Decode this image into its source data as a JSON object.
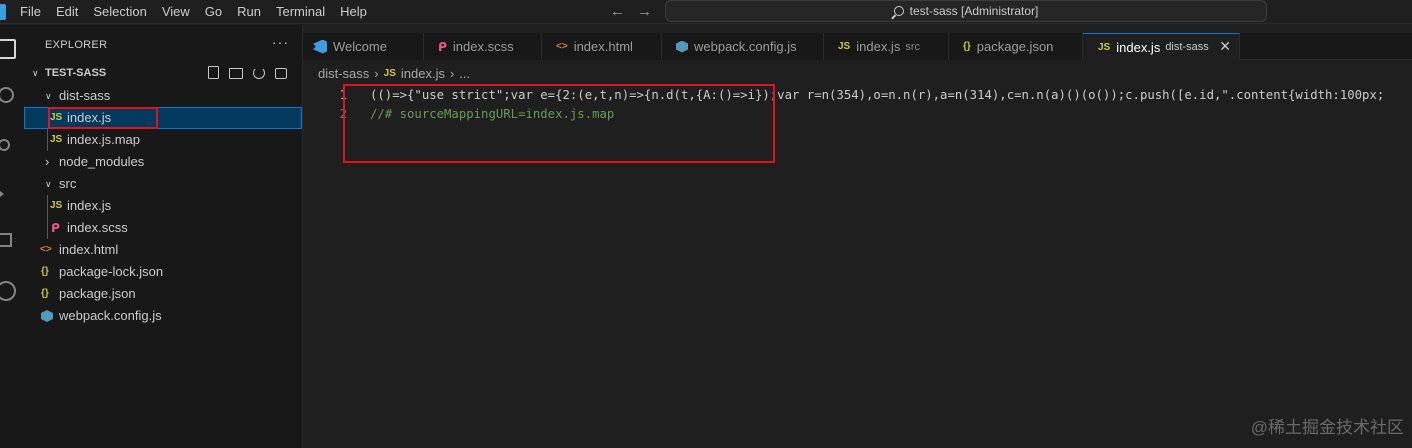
{
  "menu": [
    "File",
    "Edit",
    "Selection",
    "View",
    "Go",
    "Run",
    "Terminal",
    "Help"
  ],
  "nav": {
    "back": "←",
    "forward": "→"
  },
  "search": {
    "text": "test-sass [Administrator]"
  },
  "explorer": {
    "header": "EXPLORER",
    "more": "···",
    "section_title": "TEST-SASS",
    "tree": [
      {
        "label": "dist-sass",
        "type": "folder"
      },
      {
        "label": "index.js",
        "type": "js",
        "selected": true
      },
      {
        "label": "index.js.map",
        "type": "js"
      },
      {
        "label": "node_modules",
        "type": "folder-collapsed"
      },
      {
        "label": "src",
        "type": "folder"
      },
      {
        "label": "index.js",
        "type": "js"
      },
      {
        "label": "index.scss",
        "type": "scss"
      },
      {
        "label": "index.html",
        "type": "html"
      },
      {
        "label": "package-lock.json",
        "type": "json"
      },
      {
        "label": "package.json",
        "type": "json"
      },
      {
        "label": "webpack.config.js",
        "type": "webpack"
      }
    ],
    "icon_labels": {
      "js": "JS",
      "json": "{}",
      "html": "<>",
      "scss": "ᑭ",
      "folder_open": "∨",
      "folder_closed": "›"
    }
  },
  "tabs": [
    {
      "label": "Welcome",
      "icon": "vscode-icon"
    },
    {
      "label": "index.scss",
      "icon": "sass-icon",
      "icon_text": "ᑭ"
    },
    {
      "label": "index.html",
      "icon": "html-icon",
      "icon_text": "<>"
    },
    {
      "label": "webpack.config.js",
      "icon": "webpack-icon"
    },
    {
      "label": "index.js",
      "icon": "js-icon",
      "icon_text": "JS",
      "desc": "src"
    },
    {
      "label": "package.json",
      "icon": "json-icon",
      "icon_text": "{}"
    },
    {
      "label": "index.js",
      "icon": "js-icon",
      "icon_text": "JS",
      "desc": "dist-sass",
      "active": true,
      "close": "✕"
    }
  ],
  "breadcrumb": {
    "folder": "dist-sass",
    "sep": "›",
    "icon_text": "JS",
    "file": "index.js",
    "more": "..."
  },
  "editor": {
    "lines": [
      {
        "num": "1",
        "text": "(()=>{\"use strict\";var e={2:(e,t,n)=>{n.d(t,{A:()=>i});var r=n(354),o=n.n(r),a=n(314),c=n.n(a)()(o());c.push([e.id,\".content{width:100px;"
      },
      {
        "num": "2",
        "text": "//# sourceMappingURL=index.js.map"
      }
    ]
  },
  "watermark": "@稀土掘金技术社区",
  "colors": {
    "accent": "#0078d4",
    "highlight_box": "#e0141e",
    "selection": "#04395e"
  }
}
